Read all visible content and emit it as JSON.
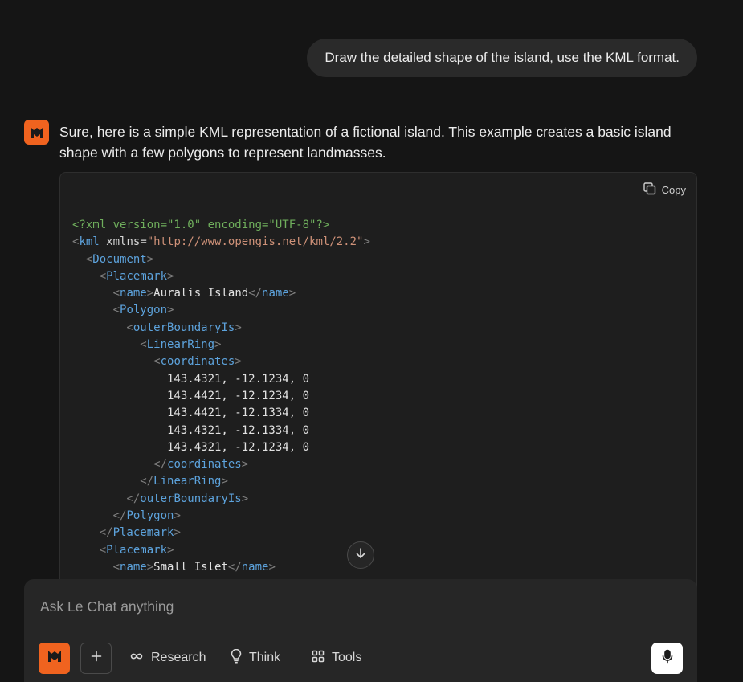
{
  "user_message": "Draw the detailed shape of the island, use the KML format.",
  "assistant": {
    "intro": "Sure, here is a simple KML representation of a fictional island. This example creates a basic island shape with a few polygons to represent landmasses.",
    "code": {
      "copy_label": "Copy",
      "lines": [
        "<?xml version=\"1.0\" encoding=\"UTF-8\"?>",
        "<kml xmlns=\"http://www.opengis.net/kml/2.2\">",
        "  <Document>",
        "    <Placemark>",
        "      <name>Auralis Island</name>",
        "      <Polygon>",
        "        <outerBoundaryIs>",
        "          <LinearRing>",
        "            <coordinates>",
        "              143.4321, -12.1234, 0",
        "              143.4421, -12.1234, 0",
        "              143.4421, -12.1334, 0",
        "              143.4321, -12.1334, 0",
        "              143.4321, -12.1234, 0",
        "            </coordinates>",
        "          </LinearRing>",
        "        </outerBoundaryIs>",
        "      </Polygon>",
        "    </Placemark>",
        "    <Placemark>",
        "      <name>Small Islet</name>"
      ]
    }
  },
  "composer": {
    "placeholder": "Ask Le Chat anything",
    "research_label": "Research",
    "think_label": "Think",
    "tools_label": "Tools"
  },
  "colors": {
    "accent": "#f0631f",
    "background": "#151515",
    "surface": "#262626"
  },
  "icons": {
    "avatar": "mistral-cat-icon",
    "copy": "copy-icon",
    "scroll": "arrow-down-icon",
    "plus": "plus-icon",
    "research": "infinity-icon",
    "think": "lightbulb-icon",
    "tools": "grid-icon",
    "mic": "microphone-icon"
  }
}
